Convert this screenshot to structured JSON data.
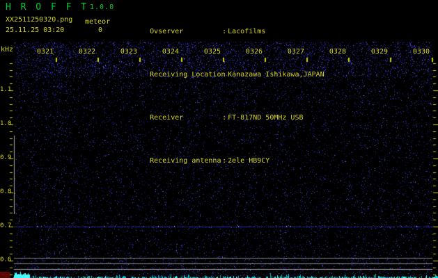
{
  "app": {
    "title": "H R O F F T",
    "version": "1.0.0"
  },
  "header": {
    "filename": "XX2511250320.png",
    "mode_label": "meteor",
    "meteor_count": "0",
    "datetime": "25.11.25 03:20",
    "separator": ":",
    "info": [
      {
        "label": "Ovserver",
        "value": "Lacofilms"
      },
      {
        "label": "Receiving Location",
        "value": "Kanazawa Ishikawa,JAPAN"
      },
      {
        "label": "Receiver",
        "value": "FT-817ND 50MHz USB"
      },
      {
        "label": "Receiving antenna",
        "value": "2ele HB9CY"
      }
    ]
  },
  "chart_data": {
    "type": "heatmap",
    "subtype": "radio-meteor-spectrogram",
    "ylabel": "kHz",
    "y_tick_labels": [
      "1.1",
      "1.0",
      "0.9",
      "0.8",
      "0.7",
      "0.6"
    ],
    "y_tick_values_khz": [
      1.1,
      1.0,
      0.9,
      0.8,
      0.7,
      0.6
    ],
    "ylim_khz": [
      0.549,
      1.243
    ],
    "y_minor_step_khz": 0.02,
    "y_minor_range_khz": [
      0.56,
      1.18
    ],
    "x_tick_labels": [
      "0321",
      "0322",
      "0323",
      "0324",
      "0325",
      "0326",
      "0327",
      "0328",
      "0329",
      "0330"
    ],
    "x_span_minutes": 10,
    "grid": "off",
    "background_noise": "sparse dark-blue speckle noise, denser bright band across the top of the plot",
    "features": {
      "carrier_lines_khz": [
        {
          "khz": 0.608,
          "color": "#8a8a8a"
        },
        {
          "khz": 0.592,
          "color": "#8a8a8a"
        },
        {
          "khz": 0.576,
          "color": "#b4b4b8"
        }
      ],
      "weak_tone_khz": 0.7,
      "vertical_line_segment": {
        "at_left_edge": true,
        "khz_from": 0.737,
        "khz_to": 0.967,
        "color": "#aaaaaa"
      },
      "noise_floor_trace": {
        "position": "bottom-edge",
        "color": "#00c8c8",
        "bright_burst_at_start": true
      },
      "corner_marker": {
        "position": "bottom-left",
        "color": "#570404"
      }
    }
  },
  "colors": {
    "bg": "#000000",
    "text_yellow": "#d4d41c",
    "text_green": "#00cc33",
    "tick": "#d0d018",
    "noise_dim": "25,25,130",
    "noise_mid": "45,45,180",
    "noise_bright": "70,70,230",
    "noise_peak": "110,110,255",
    "tone_blue": "60,60,225",
    "trace_cyan": "0,200,200",
    "trace_cyan_bright": "70,255,255"
  }
}
